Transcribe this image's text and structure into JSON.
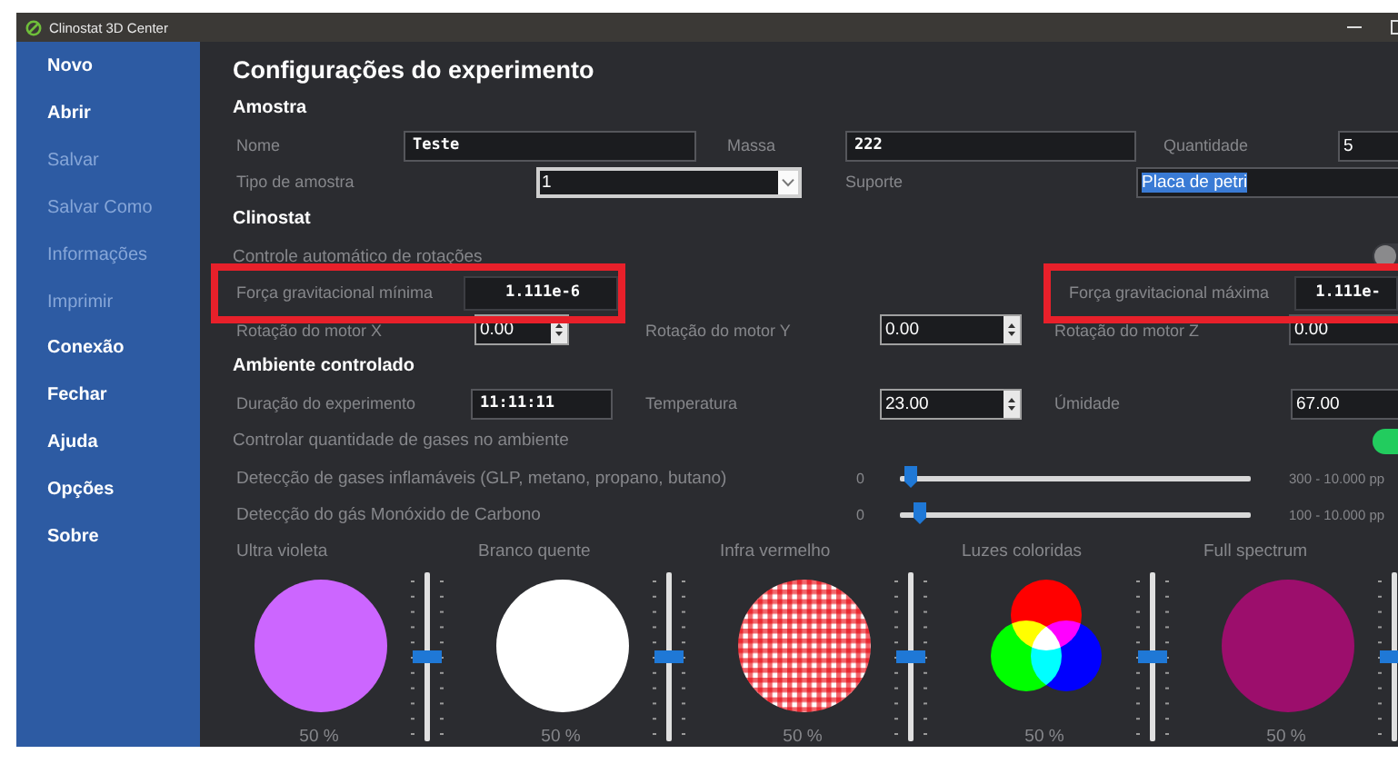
{
  "window": {
    "title": "Clinostat 3D Center"
  },
  "sidebar": {
    "items": [
      {
        "label": "Novo",
        "disabled": false
      },
      {
        "label": "Abrir",
        "disabled": false
      },
      {
        "label": "Salvar",
        "disabled": true
      },
      {
        "label": "Salvar Como",
        "disabled": true
      },
      {
        "label": "Informações",
        "disabled": true
      },
      {
        "label": "Imprimir",
        "disabled": true
      },
      {
        "label": "Conexão",
        "disabled": false
      },
      {
        "label": "Fechar",
        "disabled": false
      },
      {
        "label": "Ajuda",
        "disabled": false
      },
      {
        "label": "Opções",
        "disabled": false
      },
      {
        "label": "Sobre",
        "disabled": false
      }
    ]
  },
  "content": {
    "title": "Configurações do experimento",
    "sections": [
      {
        "title": "Amostra",
        "rows": [
          {
            "kind": "fields",
            "fields": [
              {
                "label": "Nome",
                "kind": "mono",
                "value": "Teste",
                "selected": false,
                "flagged": false
              },
              {
                "label": "Massa",
                "kind": "mono",
                "value": "222",
                "selected": false,
                "flagged": false
              },
              {
                "label": "Quantidade",
                "kind": "plain",
                "value": "5",
                "selected": false,
                "flagged": false
              }
            ]
          },
          {
            "kind": "fields",
            "fields": [
              {
                "label": "Tipo de amostra",
                "kind": "combo",
                "value": "1",
                "selected": false,
                "flagged": false
              },
              {
                "label": "Suporte",
                "kind": "plain",
                "value": "Placa de petri",
                "selected": true,
                "flagged": false
              }
            ]
          }
        ]
      },
      {
        "title": "Clinostat",
        "rows": [
          {
            "kind": "toggle",
            "label": "Controle automático de rotações",
            "on": false
          },
          {
            "kind": "fields",
            "fields": [
              {
                "label": "Força gravitacional mínima",
                "kind": "readout",
                "value": "1.111e-6",
                "selected": false,
                "flagged": true
              },
              {
                "label": "Força gravitacional máxima",
                "kind": "readout",
                "value": "1.111e-",
                "selected": false,
                "flagged": true
              }
            ]
          },
          {
            "kind": "fields",
            "fields": [
              {
                "label": "Rotação do motor X",
                "kind": "spin",
                "value": "0.00",
                "selected": false,
                "flagged": false
              },
              {
                "label": "Rotação do motor Y",
                "kind": "spin",
                "value": "0.00",
                "selected": false,
                "flagged": false
              },
              {
                "label": "Rotação do motor Z",
                "kind": "plain",
                "value": "0.00",
                "selected": false,
                "flagged": false
              }
            ]
          }
        ]
      },
      {
        "title": "Ambiente controlado",
        "rows": [
          {
            "kind": "fields",
            "fields": [
              {
                "label": "Duração do experimento",
                "kind": "mono",
                "value": "11:11:11",
                "selected": false,
                "flagged": false
              },
              {
                "label": "Temperatura",
                "kind": "spin",
                "value": "23.00",
                "selected": false,
                "flagged": false
              },
              {
                "label": "Úmidade",
                "kind": "plain",
                "value": "67.00",
                "selected": false,
                "flagged": false
              }
            ]
          },
          {
            "kind": "toggle",
            "label": "Controlar quantidade de gases no ambiente",
            "on": true
          },
          {
            "kind": "gas",
            "label": "Detecção de gases inflamáveis (GLP, metano, propano, butano)",
            "min": "0",
            "level": 0.01,
            "range": "300 - 10.000 pp"
          },
          {
            "kind": "gas",
            "label": "Detecção do gás Monóxido de Carbono",
            "min": "0",
            "level": 0.04,
            "range": "100 - 10.000 pp"
          }
        ]
      }
    ],
    "lights": [
      {
        "label": "Ultra violeta",
        "kind": "solid",
        "color": "#cc66ff",
        "level": 0.5,
        "reading": "50 %"
      },
      {
        "label": "Branco quente",
        "kind": "solid",
        "color": "#ffffff",
        "level": 0.5,
        "reading": "50 %"
      },
      {
        "label": "Infra vermelho",
        "kind": "gingham",
        "level": 0.5,
        "reading": "50 %"
      },
      {
        "label": "Luzes coloridas",
        "kind": "rgb",
        "level": 0.5,
        "reading": "50 %"
      },
      {
        "label": "Full spectrum",
        "kind": "solid",
        "color": "#9c0e6c",
        "level": 0.5,
        "reading": "50 %"
      }
    ]
  }
}
